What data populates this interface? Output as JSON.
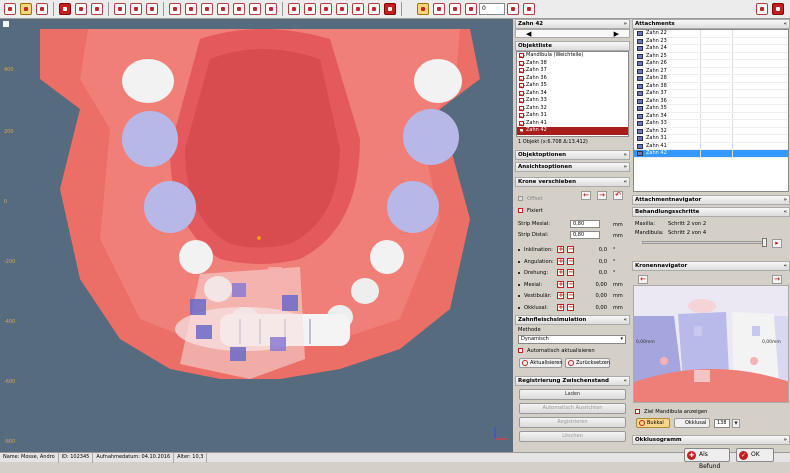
{
  "toolbar": {
    "slider_value": "0"
  },
  "status": {
    "name": "Name: Mosse, Andro",
    "id": "ID: 102345",
    "date": "Aufnahmedatum: 04.10.2016",
    "age": "Alter: 10,3"
  },
  "footer": {
    "befund": "Als Befund",
    "ok": "OK"
  },
  "zahn_panel": {
    "title": "Zahn 42"
  },
  "objektliste": {
    "title": "Objektliste",
    "items": [
      "Mandibula (Weichteile)",
      "Zahn 38",
      "Zahn 37",
      "Zahn 36",
      "Zahn 35",
      "Zahn 34",
      "Zahn 33",
      "Zahn 32",
      "Zahn 31",
      "Zahn 41",
      "Zahn 42"
    ],
    "selected_index": 10,
    "info": "1 Objekt (x:6.708 Δ:13.412)"
  },
  "objektoptionen": {
    "title": "Objektoptionen"
  },
  "ansichtsoptionen": {
    "title": "Ansichtsoptionen"
  },
  "krone": {
    "title": "Krone verschieben",
    "offset": "Offset",
    "fixiert": "Fixiert",
    "strip_mesial_label": "Strip Mesial:",
    "strip_mesial": "0,80",
    "strip_distal_label": "Strip Distal:",
    "strip_distal": "0,80",
    "mm": "mm",
    "rows": [
      {
        "label": "Inklination:",
        "value": "0,0",
        "unit": "°"
      },
      {
        "label": "Angulation:",
        "value": "0,0",
        "unit": "°"
      },
      {
        "label": "Drehung:",
        "value": "0,0",
        "unit": "°"
      },
      {
        "label": "Mesial:",
        "value": "0,00",
        "unit": "mm"
      },
      {
        "label": "Vestibulär:",
        "value": "0,00",
        "unit": "mm"
      },
      {
        "label": "Okklusal:",
        "value": "0,00",
        "unit": "mm"
      }
    ]
  },
  "zahnfleisch": {
    "title": "Zahnfleischsimulation",
    "methode_label": "Methode",
    "methode": "Dynamisch",
    "auto": "Automatisch aktualisieren",
    "aktualisieren": "Aktualisieren",
    "zuruecksetzen": "Zurücksetzen"
  },
  "registrierung": {
    "title": "Registrierung Zwischenstand",
    "buttons": [
      "Laden",
      "Automatisch Ausrichten",
      "Registrieren",
      "Löschen"
    ]
  },
  "attachments": {
    "title": "Attachments",
    "items": [
      "Zahn 22",
      "Zahn 23",
      "Zahn 24",
      "Zahn 25",
      "Zahn 26",
      "Zahn 27",
      "Zahn 28",
      "Zahn 38",
      "Zahn 37",
      "Zahn 36",
      "Zahn 35",
      "Zahn 34",
      "Zahn 33",
      "Zahn 32",
      "Zahn 31",
      "Zahn 41",
      "Zahn 42"
    ],
    "selected_index": 16
  },
  "attachmentnavigator": {
    "title": "Attachmentnavigator"
  },
  "behandlung": {
    "title": "Behandlungsschritte",
    "maxilla_label": "Maxilla:",
    "maxilla": "Schritt 2 von 2",
    "mandibula_label": "Mandibula:",
    "mandibula": "Schritt 2 von 4"
  },
  "kronennavigator": {
    "title": "Kronennavigator",
    "ziel": "Ziel Mandibula anzeigen",
    "bukkal": "Bukkal",
    "okklusal": "Okklusal",
    "zoom": "138",
    "measure_left": "0,00mm",
    "measure_right": "0,00mm"
  },
  "okklusogramm": {
    "title": "Okklusogramm"
  },
  "axis_ticks": [
    "400",
    "200",
    "0",
    "-200",
    "-400",
    "-600",
    "-800"
  ]
}
